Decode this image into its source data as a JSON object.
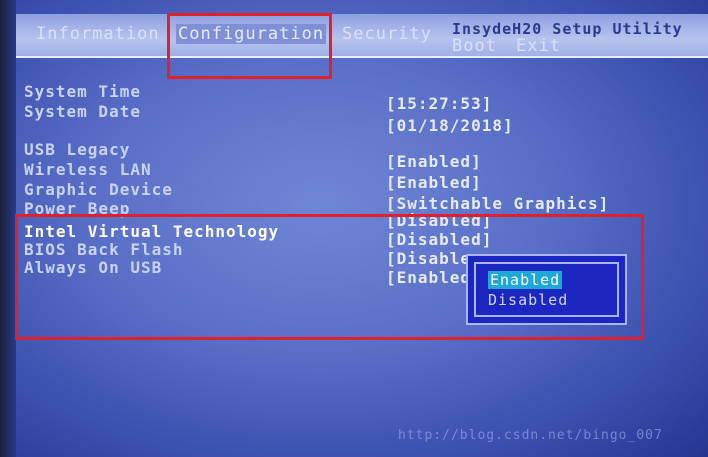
{
  "header": {
    "title": "InsydeH20 Setup Utility",
    "tabs": [
      {
        "label": "Information"
      },
      {
        "label": "Configuration"
      },
      {
        "label": "Security"
      },
      {
        "label": "Boot"
      },
      {
        "label": "Exit"
      }
    ]
  },
  "settings": [
    {
      "label": "System Time",
      "value": "[15:27:53]"
    },
    {
      "label": "System Date",
      "value": "[01/18/2018]"
    },
    {
      "label": "USB Legacy",
      "value": "[Enabled]"
    },
    {
      "label": "Wireless LAN",
      "value": "[Enabled]"
    },
    {
      "label": "Graphic Device",
      "value": "[Switchable Graphics]"
    },
    {
      "label": "Power Beep",
      "value": "[Disabled]"
    },
    {
      "label": "Intel Virtual Technology",
      "value": "[Disabled]"
    },
    {
      "label": "BIOS Back Flash",
      "value": "[Disable"
    },
    {
      "label": "Always On USB",
      "value": "[Enabled"
    }
  ],
  "popup": {
    "options": [
      "Enabled",
      "Disabled"
    ]
  },
  "watermark": "http://blog.csdn.net/bingo_007",
  "colors": {
    "annotation": "#e3202a",
    "popup_bg": "#1c27c2",
    "selected_bg": "#1ea8d8"
  }
}
